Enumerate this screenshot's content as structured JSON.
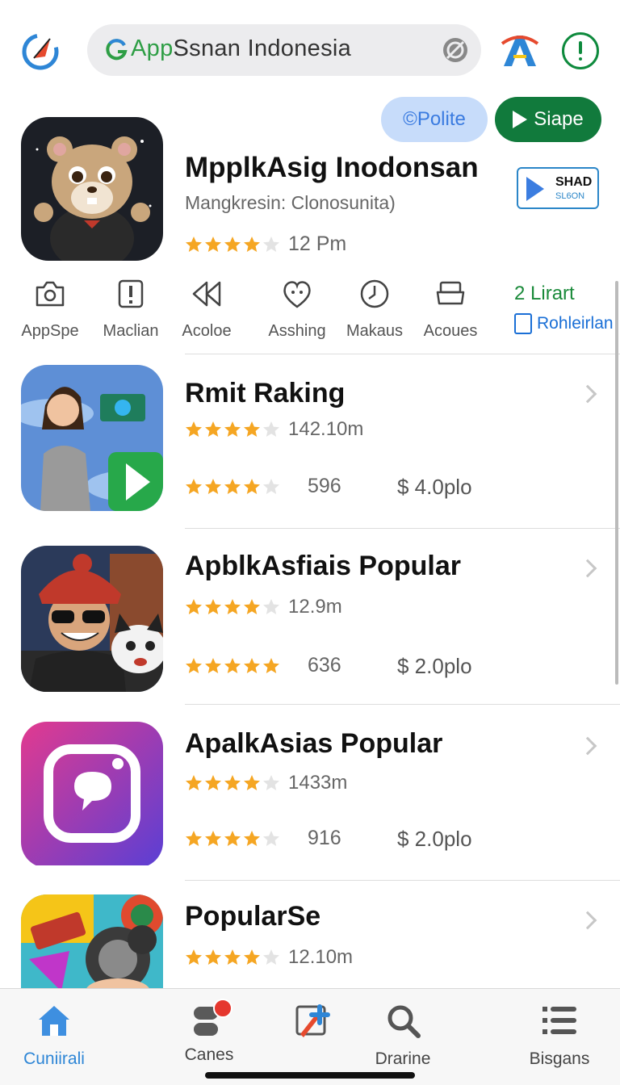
{
  "header": {
    "search_text_app": "App",
    "search_text_rest": "Ssnan Indonesia",
    "icons": [
      "compass-logo-icon",
      "google-icon",
      "mic-icon",
      "a-logo-icon",
      "info-icon"
    ]
  },
  "featured": {
    "polite_label": "©Polite",
    "siape_label": "Siape",
    "title": "MpplkAsig Inodonsan",
    "subtitle": "Mangkresin: Clonosunita)",
    "rating": 4,
    "rating_count": "12 Pm",
    "badge_line1": "SHAD",
    "badge_line2": "SL6ON"
  },
  "categories": [
    {
      "label": "AppSpe",
      "icon": "camera-icon"
    },
    {
      "label": "Maclian",
      "icon": "warning-icon"
    },
    {
      "label": "Acoloe",
      "icon": "rewind-icon"
    },
    {
      "label": "Asshing",
      "icon": "heart-face-icon"
    },
    {
      "label": "Makaus",
      "icon": "clock-icon"
    },
    {
      "label": "Acoues",
      "icon": "tray-icon"
    }
  ],
  "categories_right": {
    "line1": "2 Lirart",
    "line2": "Rohleirlan"
  },
  "apps": [
    {
      "title": "Rmit Raking",
      "rating": 4,
      "count": "142.10m",
      "reviews": "596",
      "price": "$ 4.0plo",
      "rating2": 4
    },
    {
      "title": "ApblkAsfiais Popular",
      "rating": 4,
      "count": "12.9m",
      "reviews": "636",
      "price": "$ 2.0plo",
      "rating2": 5
    },
    {
      "title": "ApalkAsias Popular",
      "rating": 4,
      "count": "1433m",
      "reviews": "916",
      "price": "$ 2.0plo",
      "rating2": 4
    },
    {
      "title": "PopularSe",
      "rating": 4,
      "count": "12.10m",
      "reviews": "",
      "price": "",
      "rating2": 0
    }
  ],
  "tabs": [
    {
      "label": "Cuniirali",
      "icon": "home-icon",
      "active": true
    },
    {
      "label": "Canes",
      "icon": "games-icon",
      "active": false
    },
    {
      "label": "",
      "icon": "pencil-plus-icon",
      "active": false
    },
    {
      "label": "Drarine",
      "icon": "search-icon",
      "active": false
    },
    {
      "label": "Bisgans",
      "icon": "list-icon",
      "active": false
    }
  ],
  "colors": {
    "accent_green": "#117a3c",
    "accent_blue": "#2e86d6",
    "star": "#f5a623"
  }
}
